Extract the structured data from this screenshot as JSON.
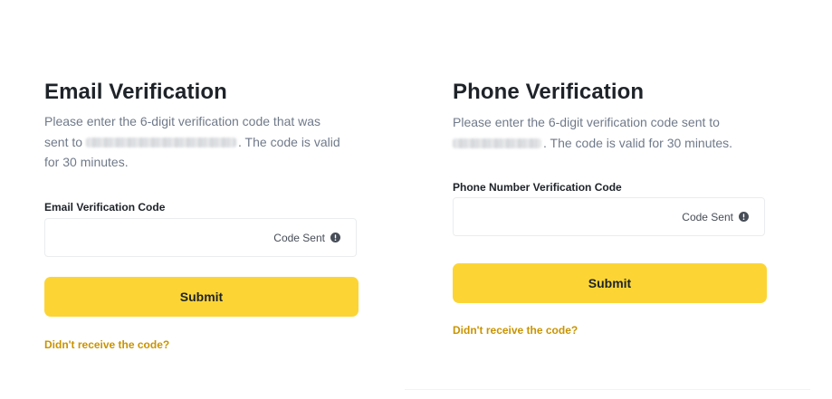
{
  "email_panel": {
    "title": "Email Verification",
    "desc_prefix": "Please enter the 6-digit verification code that was sent to",
    "desc_suffix": ". The code is valid for 30 minutes.",
    "field_label": "Email Verification Code",
    "code_sent_label": "Code Sent",
    "submit_label": "Submit",
    "resend_link": "Didn't receive the code?"
  },
  "phone_panel": {
    "title": "Phone Verification",
    "desc_prefix": "Please enter the 6-digit verification code sent to",
    "desc_suffix": ". The code is valid for 30 minutes.",
    "field_label": "Phone Number Verification Code",
    "code_sent_label": "Code Sent",
    "submit_label": "Submit",
    "resend_link": "Didn't receive the code?"
  },
  "colors": {
    "accent_yellow": "#fcd535",
    "link_gold": "#c99400",
    "title_text": "#1e2329",
    "muted_text": "#707a8a",
    "field_border": "#eaecef"
  },
  "icons": {
    "code_sent_status": "info-icon"
  }
}
